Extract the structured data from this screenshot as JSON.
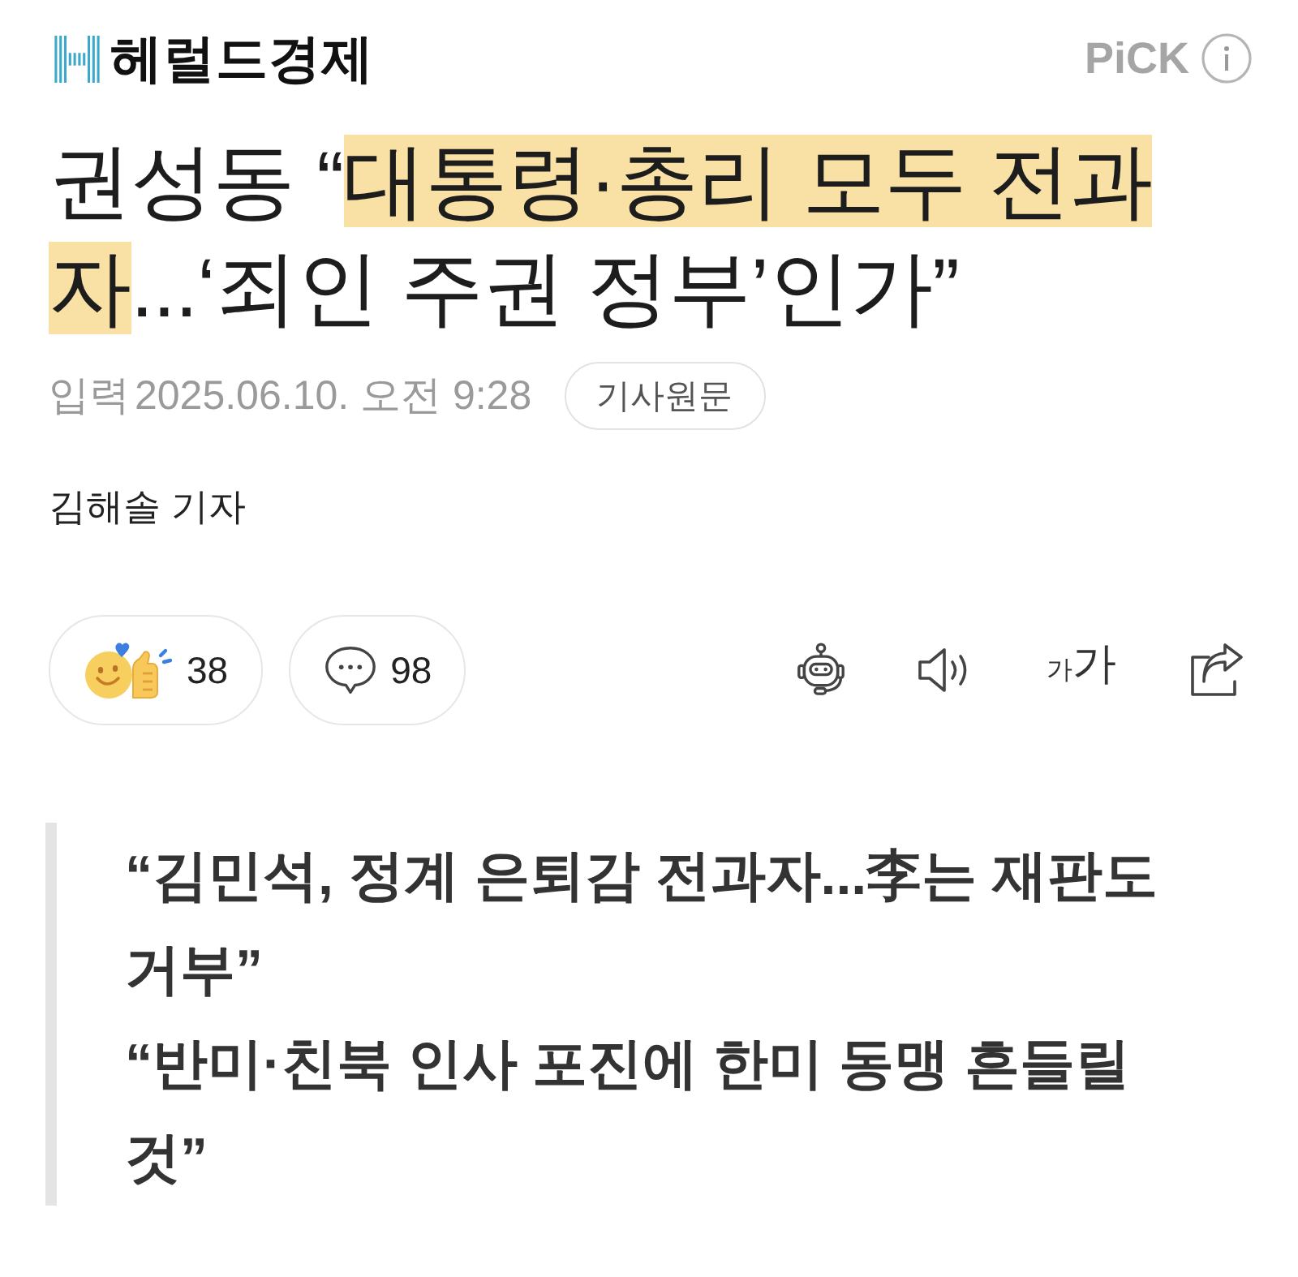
{
  "header": {
    "logo_text": "헤럴드경제",
    "pick_label": "PiCK"
  },
  "headline": [
    {
      "text": "권성동 “",
      "highlighted": false
    },
    {
      "text": "대통령·총리 모두 전과자",
      "highlighted": true
    },
    {
      "text": "...‘죄인 주권 정부’인가”",
      "highlighted": false
    }
  ],
  "meta": {
    "label": "입력",
    "datetime": "2025.06.10. 오전 9:28",
    "source_button": "기사원문"
  },
  "byline": "김해솔 기자",
  "actions": [
    {
      "kind": "reaction",
      "count": "38"
    },
    {
      "kind": "comment",
      "count": "98"
    }
  ],
  "tools": [
    {
      "kind": "robot"
    },
    {
      "kind": "speaker"
    },
    {
      "kind": "font_size",
      "small": "가",
      "large": "가"
    },
    {
      "kind": "share"
    }
  ],
  "quotes": [
    "“김민석, 정계 은퇴감 전과자...李는 재판도 거부”",
    "“반미·친북 인사 포진에 한미 동맹 흔들릴 것”"
  ]
}
